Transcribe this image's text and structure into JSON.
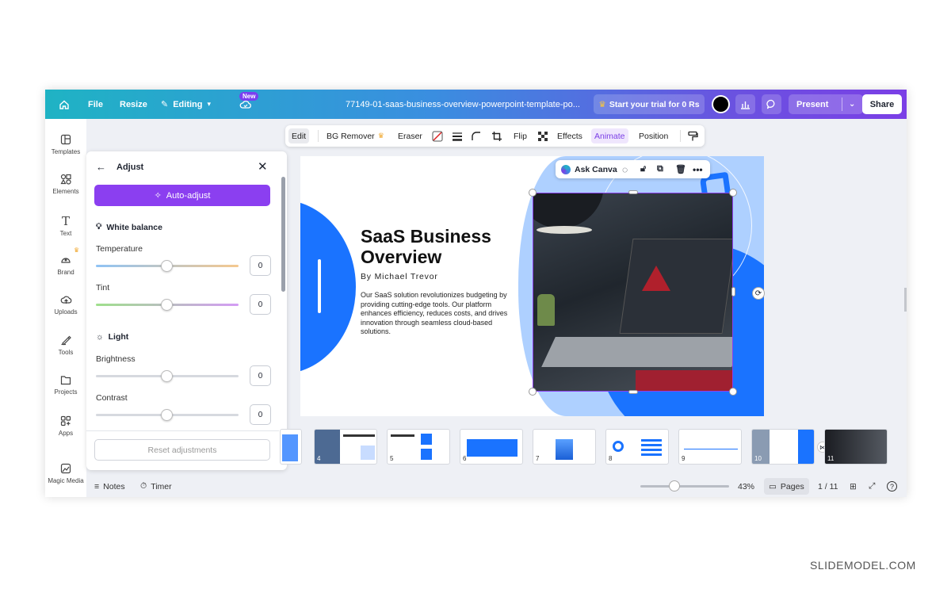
{
  "topbar": {
    "file": "File",
    "resize": "Resize",
    "editing": "Editing",
    "new_badge": "New",
    "doc_title": "77149-01-saas-business-overview-powerpoint-template-po...",
    "trial": "Start your trial for 0 Rs",
    "present": "Present",
    "share": "Share"
  },
  "rail": {
    "templates": "Templates",
    "elements": "Elements",
    "text": "Text",
    "brand": "Brand",
    "uploads": "Uploads",
    "tools": "Tools",
    "projects": "Projects",
    "apps": "Apps",
    "magic_media": "Magic Media"
  },
  "panel": {
    "title": "Adjust",
    "auto_adjust": "Auto-adjust",
    "white_balance": "White balance",
    "temperature": "Temperature",
    "temperature_value": "0",
    "tint": "Tint",
    "tint_value": "0",
    "light": "Light",
    "brightness": "Brightness",
    "brightness_value": "0",
    "contrast": "Contrast",
    "contrast_value": "0",
    "reset": "Reset adjustments"
  },
  "toolbar": {
    "edit": "Edit",
    "bg_remover": "BG Remover",
    "eraser": "Eraser",
    "flip": "Flip",
    "effects": "Effects",
    "animate": "Animate",
    "position": "Position"
  },
  "canvas": {
    "ask_canva": "Ask Canva",
    "slide_title_1": "SaaS Business",
    "slide_title_2": "Overview",
    "author": "By Michael Trevor",
    "body": "Our SaaS solution revolutionizes budgeting by providing cutting-edge tools. Our platform enhances efficiency, reduces costs, and drives innovation through seamless cloud-based solutions."
  },
  "thumbnails": [
    "4",
    "5",
    "6",
    "7",
    "8",
    "9",
    "10",
    "11"
  ],
  "bottombar": {
    "notes": "Notes",
    "timer": "Timer",
    "zoom": "43%",
    "pages": "Pages",
    "page_count": "1 / 11"
  },
  "watermark": "SLIDEMODEL.COM",
  "colors": {
    "accent": "#7b3fe6",
    "brand_blue": "#1a73ff"
  }
}
